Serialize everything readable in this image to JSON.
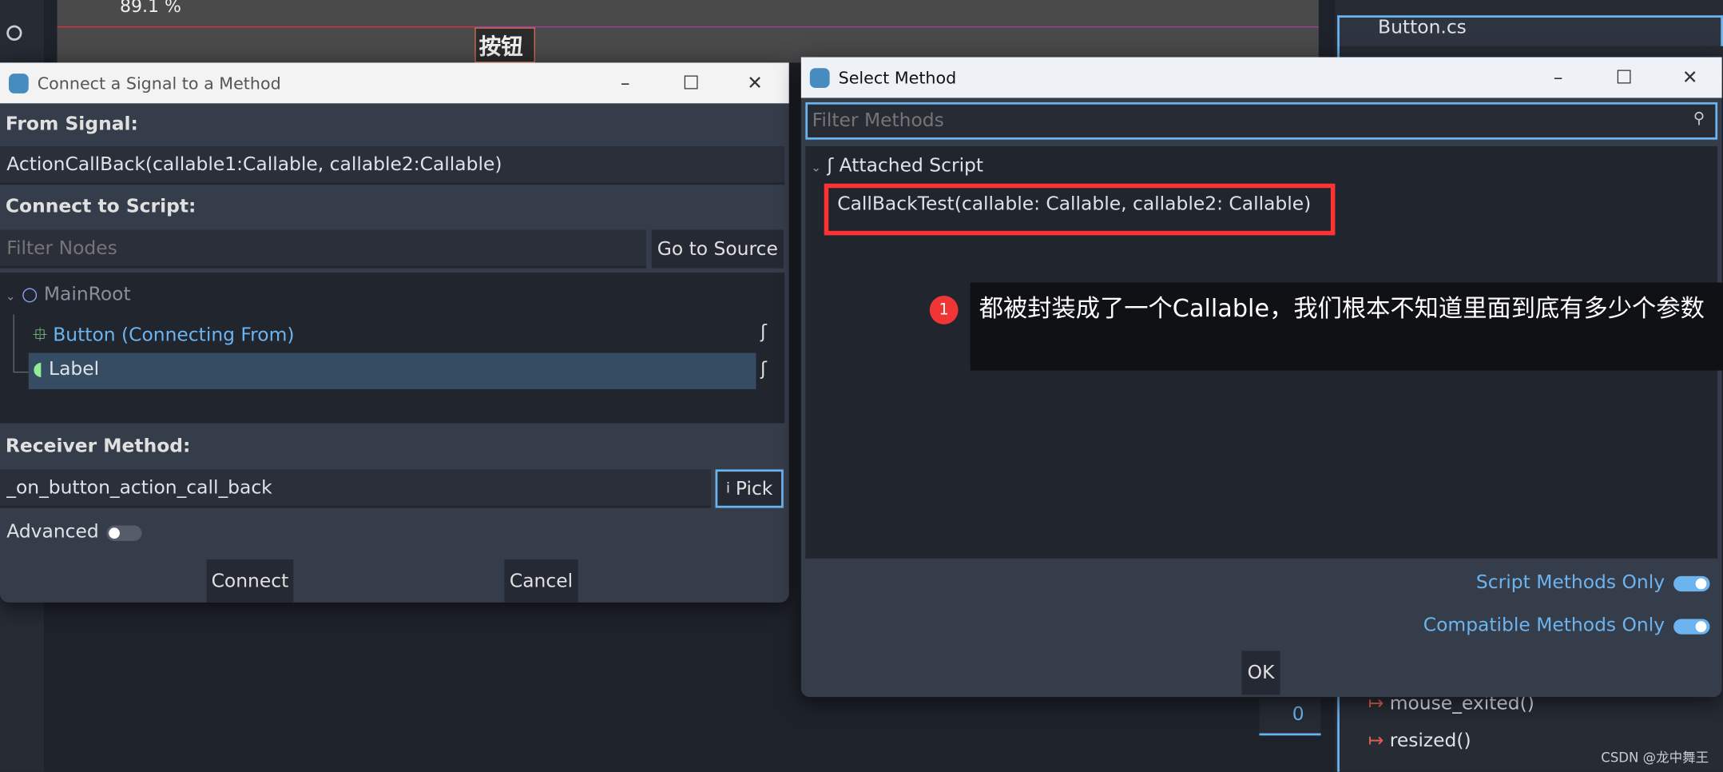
{
  "editor": {
    "zoom_level": "89.1 %",
    "canvas_node_text": "按钮",
    "right_panel": {
      "tree_root": "Button.cs",
      "signals": [
        "mouse_exited()",
        "resized()"
      ]
    },
    "counter": "0"
  },
  "connect_dialog": {
    "title": "Connect a Signal to a Method",
    "from_signal_label": "From Signal:",
    "signal": "ActionCallBack(callable1:Callable, callable2:Callable)",
    "connect_to_script_label": "Connect to Script:",
    "filter_nodes_placeholder": "Filter Nodes",
    "go_to_source": "Go to Source",
    "tree": {
      "root": "MainRoot",
      "items": [
        {
          "label": "Button (Connecting From)"
        },
        {
          "label": "Label",
          "selected": true
        }
      ]
    },
    "receiver_method_label": "Receiver Method:",
    "receiver_method": "_on_button_action_call_back",
    "pick": "Pick",
    "advanced": "Advanced",
    "advanced_enabled": false,
    "connect": "Connect",
    "cancel": "Cancel"
  },
  "select_method_dialog": {
    "title": "Select Method",
    "filter_placeholder": "Filter Methods",
    "group": "Attached Script",
    "methods": [
      "CallBackTest(callable: Callable, callable2: Callable)"
    ],
    "script_methods_only": "Script Methods Only",
    "script_methods_only_enabled": true,
    "compatible_methods_only": "Compatible Methods Only",
    "compatible_methods_only_enabled": true,
    "ok": "OK"
  },
  "annotation": {
    "number": "1",
    "text": "都被封装成了一个Callable，我们根本不知道里面到底有多少个参数"
  },
  "watermark": "CSDN @龙中舞王",
  "colors": {
    "accent": "#6cb4f0",
    "highlight": "#ff3333",
    "selected_row": "#364c63"
  }
}
